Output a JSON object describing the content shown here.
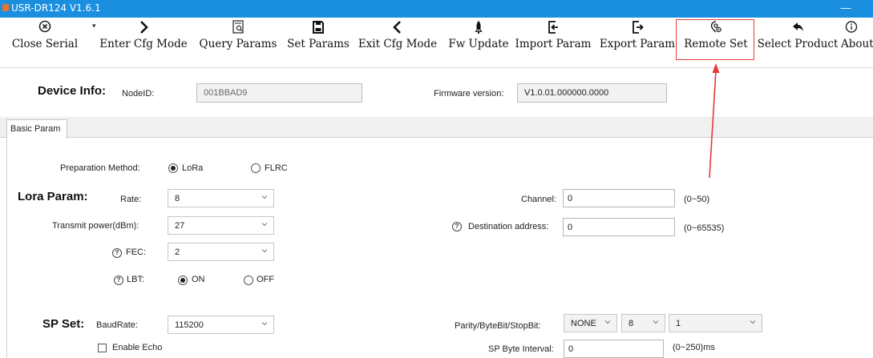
{
  "window": {
    "title": "USR-DR124 V1.6.1",
    "minimize": "—"
  },
  "toolbar": {
    "items": [
      {
        "label": "Close Serial",
        "icon": "close-circle-icon"
      },
      {
        "label": "Enter Cfg Mode",
        "icon": "chevron-right-icon"
      },
      {
        "label": "Query Params",
        "icon": "query-doc-icon"
      },
      {
        "label": "Set Params",
        "icon": "save-icon"
      },
      {
        "label": "Exit Cfg Mode",
        "icon": "chevron-left-icon"
      },
      {
        "label": "Fw Update",
        "icon": "rocket-icon"
      },
      {
        "label": "Import Param",
        "icon": "import-icon"
      },
      {
        "label": "Export Param",
        "icon": "export-icon"
      },
      {
        "label": "Remote Set",
        "icon": "remote-gear-icon"
      },
      {
        "label": "Select Product",
        "icon": "reply-arrow-icon"
      },
      {
        "label": "About",
        "icon": "info-icon"
      }
    ],
    "highlight_color": "#e53935"
  },
  "device": {
    "heading": "Device Info:",
    "node_label": "NodeID:",
    "node_value": "001BBAD9",
    "fw_label": "Firmware version:",
    "fw_value": "V1.0.01.000000.0000"
  },
  "tabs": [
    {
      "label": "Basic Param"
    }
  ],
  "basic": {
    "prep_label": "Preparation Method:",
    "prep_options": [
      "LoRa",
      "FLRC"
    ],
    "prep_selected": "LoRa",
    "lora_heading": "Lora Param:",
    "rate_label": "Rate:",
    "rate_value": "8",
    "power_label": "Transmit power(dBm):",
    "power_value": "27",
    "fec_label": "FEC:",
    "fec_value": "2",
    "lbt_label": "LBT:",
    "lbt_options": [
      "ON",
      "OFF"
    ],
    "lbt_selected": "ON",
    "channel_label": "Channel:",
    "channel_value": "0",
    "channel_range": "(0~50)",
    "dest_label": "Destination address:",
    "dest_value": "0",
    "dest_range": "(0~65535)",
    "sp_heading": "SP Set:",
    "baud_label": "BaudRate:",
    "baud_value": "115200",
    "echo_label": "Enable Echo",
    "parity_label": "Parity/ByteBit/StopBit:",
    "parity_value": "NONE",
    "bytebit_value": "8",
    "stopbit_value": "1",
    "interval_label": "SP Byte Interval:",
    "interval_value": "0",
    "interval_range": "(0~250)ms"
  },
  "colors": {
    "titlebar": "#1a8fe0",
    "accent_red": "#e53935"
  }
}
